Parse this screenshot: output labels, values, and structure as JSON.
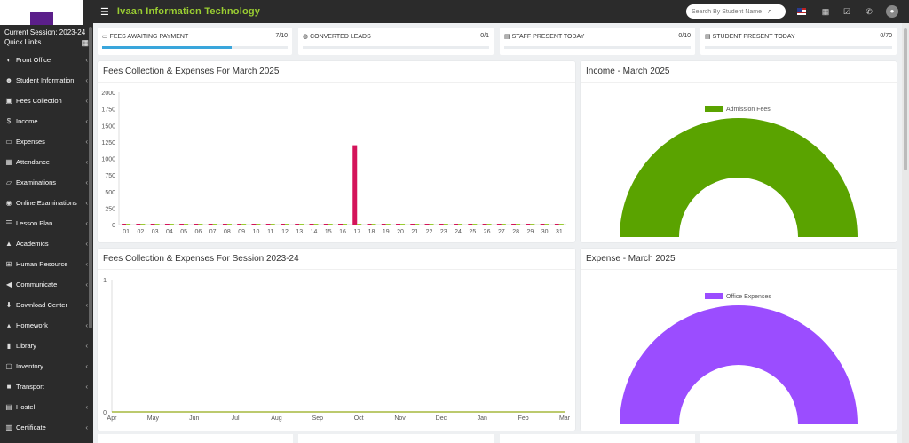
{
  "app": {
    "brand": "Ivaan Information Technology"
  },
  "sidebar": {
    "session": "Current Session: 2023-24",
    "quick_links": "Quick Links",
    "items": [
      {
        "label": "Front Office",
        "icon": "desk-icon"
      },
      {
        "label": "Student Information",
        "icon": "users-icon"
      },
      {
        "label": "Fees Collection",
        "icon": "money-icon"
      },
      {
        "label": "Income",
        "icon": "dollar-icon"
      },
      {
        "label": "Expenses",
        "icon": "card-icon"
      },
      {
        "label": "Attendance",
        "icon": "calendar-icon"
      },
      {
        "label": "Examinations",
        "icon": "map-icon"
      },
      {
        "label": "Online Examinations",
        "icon": "rss-icon"
      },
      {
        "label": "Lesson Plan",
        "icon": "list-icon"
      },
      {
        "label": "Academics",
        "icon": "cap-icon"
      },
      {
        "label": "Human Resource",
        "icon": "sitemap-icon"
      },
      {
        "label": "Communicate",
        "icon": "bullhorn-icon"
      },
      {
        "label": "Download Center",
        "icon": "download-icon"
      },
      {
        "label": "Homework",
        "icon": "flask-icon"
      },
      {
        "label": "Library",
        "icon": "book-icon"
      },
      {
        "label": "Inventory",
        "icon": "object-icon"
      },
      {
        "label": "Transport",
        "icon": "bus-icon"
      },
      {
        "label": "Hostel",
        "icon": "building-icon"
      },
      {
        "label": "Certificate",
        "icon": "newspaper-icon"
      }
    ]
  },
  "header": {
    "search_placeholder": "Search By Student Name"
  },
  "stats": [
    {
      "title": "Fees Awaiting Payment",
      "value": "7/10",
      "progress": 0.7
    },
    {
      "title": "Converted Leads",
      "value": "0/1",
      "progress": 0
    },
    {
      "title": "Staff Present Today",
      "value": "0/10",
      "progress": 0
    },
    {
      "title": "Student Present Today",
      "value": "0/70",
      "progress": 0
    }
  ],
  "panels": {
    "march_title": "Fees Collection & Expenses For March 2025",
    "session_title": "Fees Collection & Expenses For Session 2023-24",
    "income_title": "Income - March 2025",
    "expense_title": "Expense - March 2025"
  },
  "colors": {
    "fees_bar": "#d4145a",
    "expense_bar": "#9acd32",
    "income_donut": "#5aa300",
    "expense_donut": "#9b4dff",
    "brand": "#9acd32"
  },
  "chart_data": [
    {
      "type": "bar",
      "title": "Fees Collection & Expenses For March 2025",
      "categories": [
        "01",
        "02",
        "03",
        "04",
        "05",
        "06",
        "07",
        "08",
        "09",
        "10",
        "11",
        "12",
        "13",
        "14",
        "15",
        "16",
        "17",
        "18",
        "19",
        "20",
        "21",
        "22",
        "23",
        "24",
        "25",
        "26",
        "27",
        "28",
        "29",
        "30",
        "31"
      ],
      "series": [
        {
          "values": [
            0,
            0,
            0,
            0,
            0,
            0,
            0,
            0,
            0,
            0,
            0,
            0,
            0,
            0,
            0,
            0,
            1200,
            0,
            0,
            0,
            0,
            0,
            0,
            0,
            0,
            0,
            0,
            0,
            0,
            0,
            0
          ]
        },
        {
          "values": [
            0,
            0,
            0,
            0,
            0,
            0,
            0,
            0,
            0,
            0,
            0,
            0,
            0,
            0,
            0,
            0,
            0,
            0,
            0,
            0,
            0,
            0,
            0,
            0,
            0,
            0,
            0,
            0,
            0,
            0,
            0
          ]
        }
      ],
      "yticks": [
        0,
        250,
        500,
        750,
        1000,
        1250,
        1500,
        1750,
        2000
      ],
      "ylim": [
        0,
        2000
      ]
    },
    {
      "type": "line",
      "title": "Fees Collection & Expenses For Session 2023-24",
      "categories": [
        "Apr",
        "May",
        "Jun",
        "Jul",
        "Aug",
        "Sep",
        "Oct",
        "Nov",
        "Dec",
        "Jan",
        "Feb",
        "Mar"
      ],
      "series": [
        {
          "values": [
            0,
            0,
            0,
            0,
            0,
            0,
            0,
            0,
            0,
            0,
            0,
            0
          ]
        },
        {
          "values": [
            0,
            0,
            0,
            0,
            0,
            0,
            0,
            0,
            0,
            0,
            0,
            0
          ]
        }
      ],
      "yticks": [
        0,
        1
      ],
      "ylim": [
        0,
        1
      ]
    },
    {
      "type": "pie",
      "title": "Income - March 2025",
      "labels": [
        "Admission Fees"
      ],
      "values": [
        100
      ],
      "legend": "top"
    },
    {
      "type": "pie",
      "title": "Expense - March 2025",
      "labels": [
        "Office Expenses"
      ],
      "values": [
        100
      ],
      "legend": "top"
    }
  ]
}
